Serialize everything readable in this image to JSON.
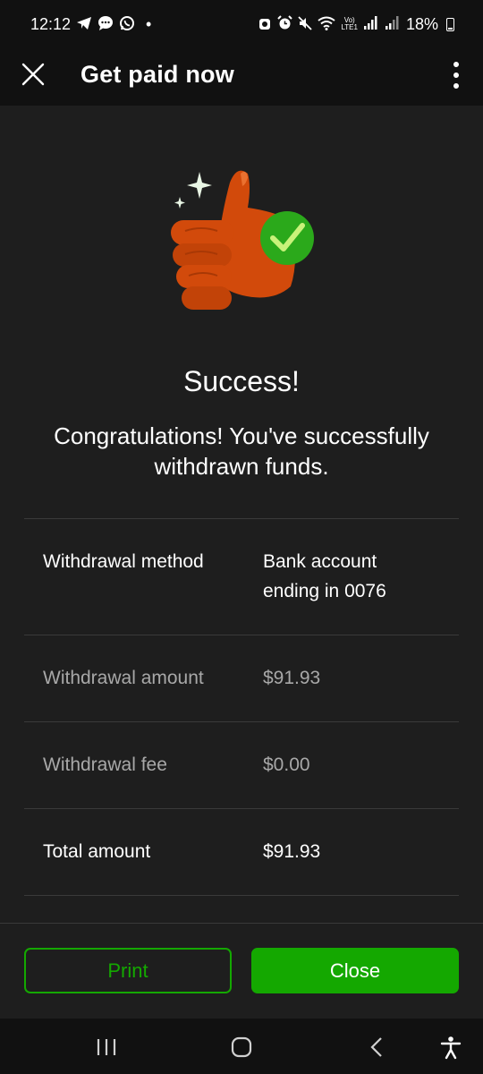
{
  "status_bar": {
    "time": "12:12",
    "left_icons": [
      "telegram-icon",
      "messages-icon",
      "whatsapp-icon"
    ],
    "dot": "•",
    "right_icons": [
      "alarm-icon",
      "mute-icon",
      "wifi-icon",
      "volte-icon",
      "signal-icon"
    ],
    "volte_label_top": "Vo)",
    "volte_label_bottom": "LTE1",
    "battery": "18%"
  },
  "app_bar": {
    "title": "Get paid now"
  },
  "content": {
    "headline": "Success!",
    "message": "Congratulations! You've successfully withdrawn funds.",
    "details": [
      {
        "label": "Withdrawal method",
        "value_line1": "Bank account",
        "value_line2": "ending in 0076"
      },
      {
        "label": "Withdrawal amount",
        "value": "$91.93"
      },
      {
        "label": "Withdrawal fee",
        "value": "$0.00"
      },
      {
        "label": "Total amount",
        "value": "$91.93"
      }
    ]
  },
  "actions": {
    "print_label": "Print",
    "close_label": "Close"
  },
  "colors": {
    "accent": "#14a800",
    "background": "#1e1e1e",
    "bar": "#111111",
    "thumb": "#d24a0b",
    "check": "#2ba91b"
  }
}
